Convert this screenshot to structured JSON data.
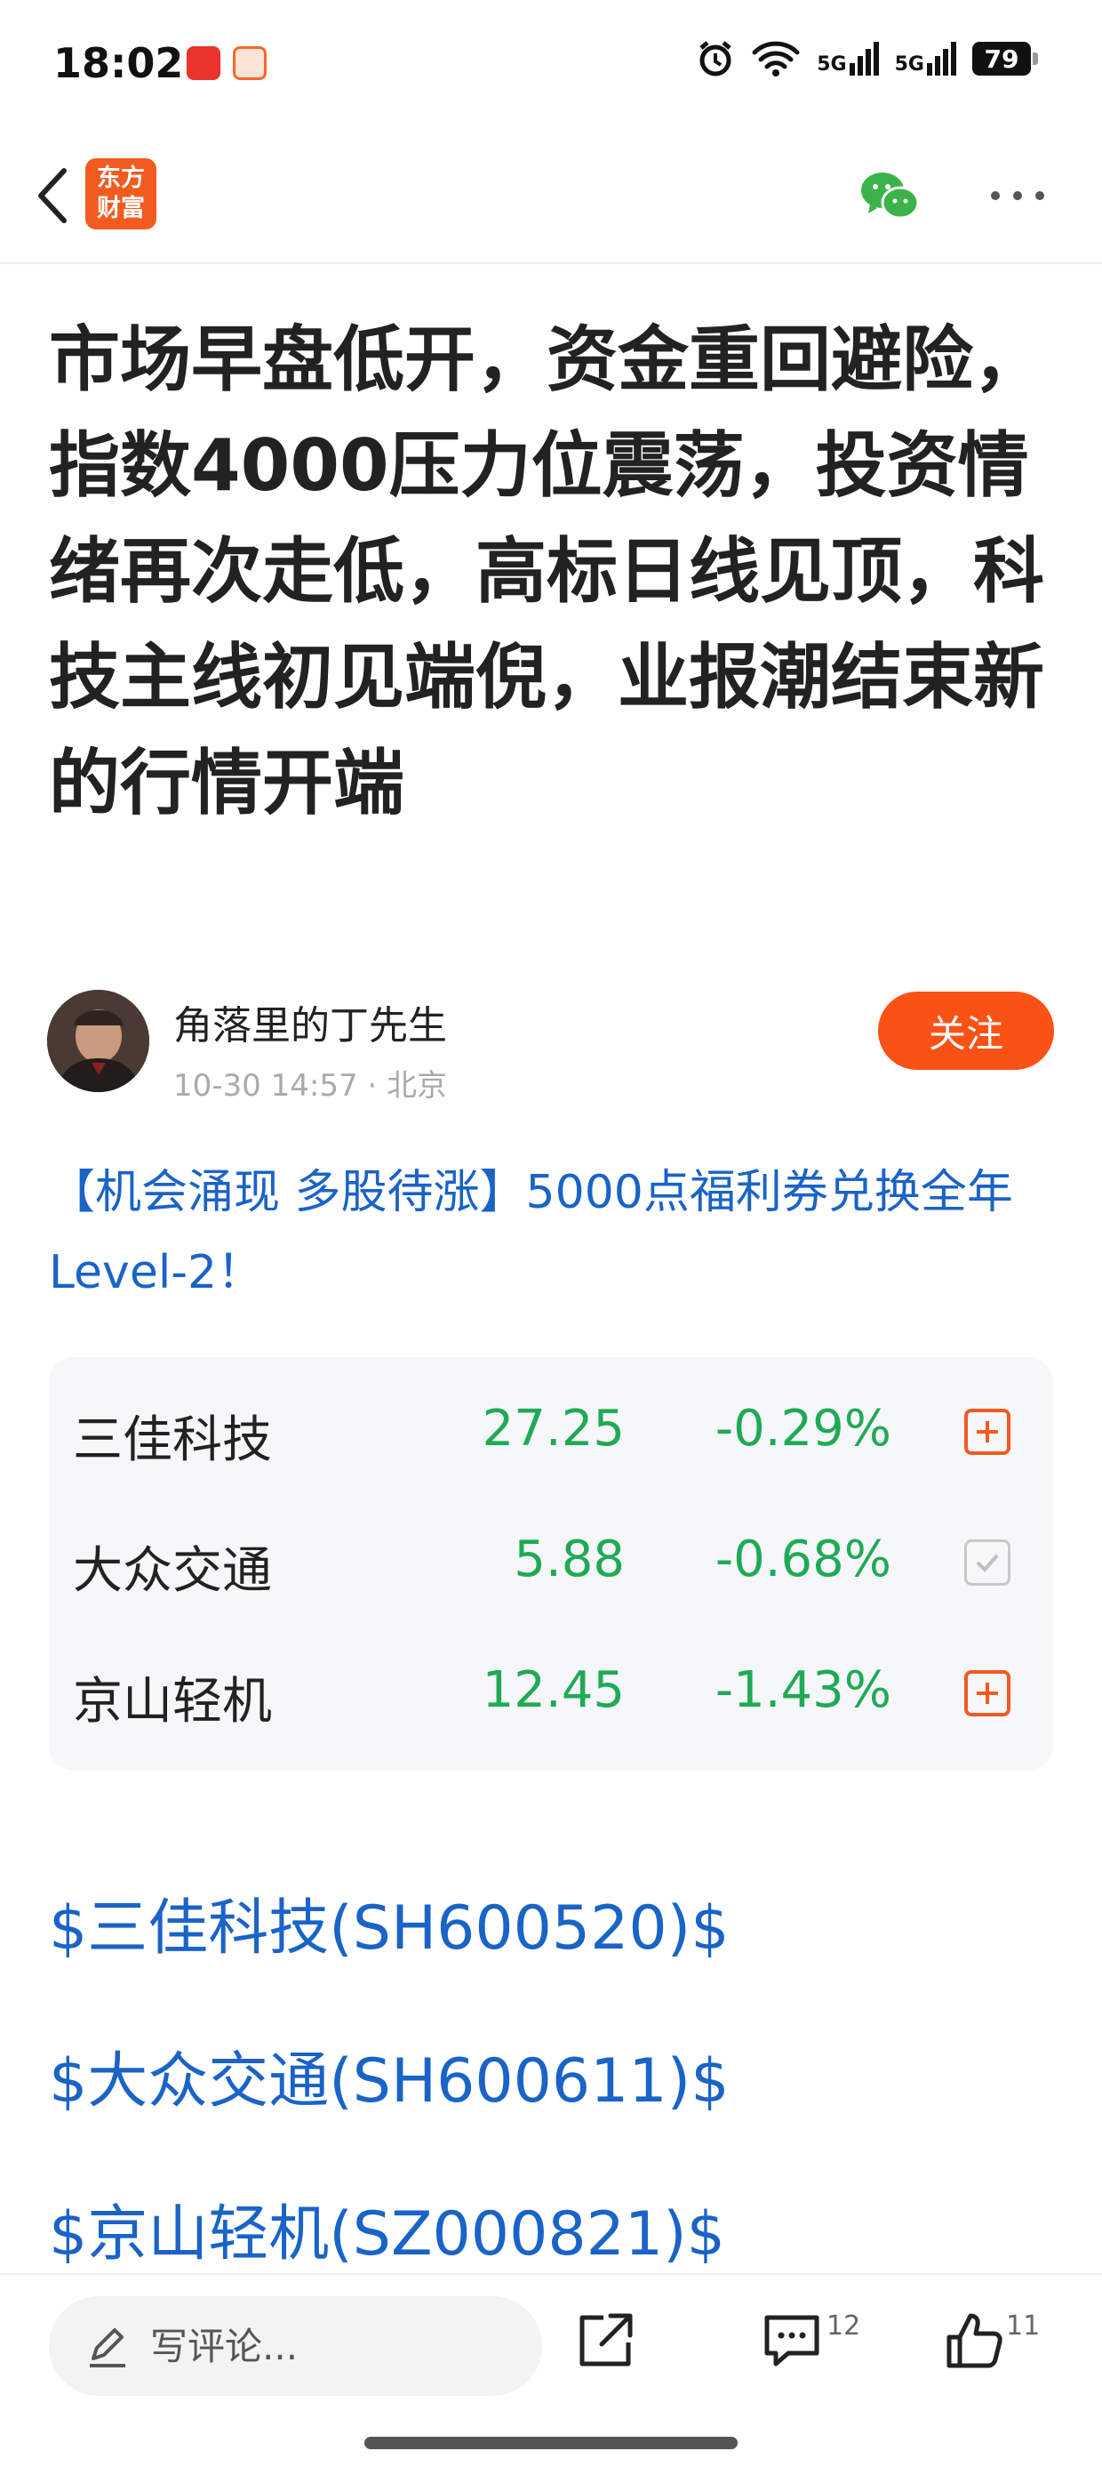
{
  "status_bar": {
    "time": "18:02",
    "network_1": "5G",
    "network_2": "5G",
    "battery": "79"
  },
  "header": {
    "logo_line1": "东方",
    "logo_line2": "财富"
  },
  "article": {
    "title": "市场早盘低开，资金重回避险，指数4000压力位震荡，投资情绪再次走低，高标日线见顶，科技主线初见端倪，业报潮结束新的行情开端",
    "author": "角落里的丁先生",
    "meta": "10-30 14:57 · 北京",
    "follow_label": "关注",
    "promo": "【机会涌现 多股待涨】5000点福利券兑换全年Level-2！"
  },
  "stocks": [
    {
      "name": "三佳科技",
      "price": "27.25",
      "change": "-0.29%",
      "action": "add"
    },
    {
      "name": "大众交通",
      "price": "5.88",
      "change": "-0.68%",
      "action": "added"
    },
    {
      "name": "京山轻机",
      "price": "12.45",
      "change": "-1.43%",
      "action": "add"
    }
  ],
  "tags": [
    "$三佳科技(SH600520)$",
    "$大众交通(SH600611)$",
    "$京山轻机(SZ000821)$"
  ],
  "bottom_bar": {
    "comment_placeholder": "写评论...",
    "comment_count": "12",
    "like_count": "11"
  },
  "colors": {
    "brand": "#f25a1f",
    "link": "#1a63c7",
    "down": "#1faa55"
  }
}
